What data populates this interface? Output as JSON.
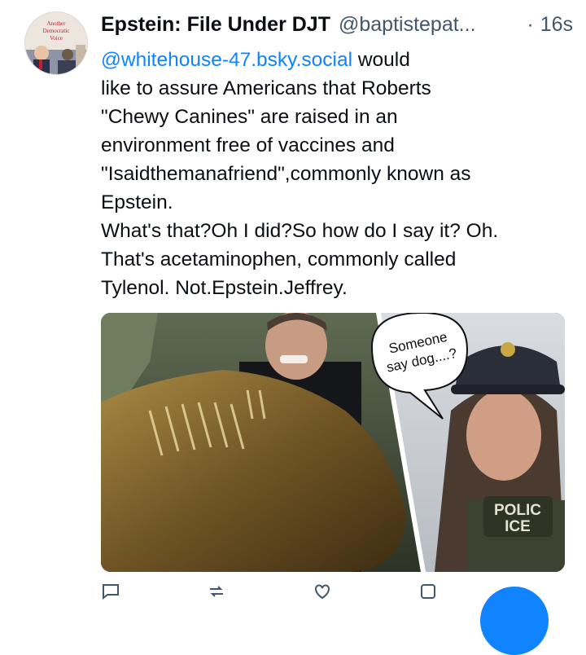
{
  "post": {
    "author": "Epstein: File Under DJT",
    "handle": "@baptistepat...",
    "separator": "·",
    "time": "16s",
    "avatar_text": "Another Democratic Voice",
    "mention": "@whitehouse-47.bsky.social",
    "lines": [
      " would",
      "like to assure Americans that Roberts",
      "\"Chewy Canines\" are raised in an",
      "environment free of vaccines and",
      "\"Isaidthemanafriend\",commonly known as",
      "Epstein.",
      "What's that?Oh I did?So how do I say it? Oh.",
      "That's acetaminophen, commonly called",
      "Tylenol. Not.Epstein.Jeffrey."
    ],
    "image": {
      "speech_bubble": [
        "Someone",
        "say dog....?"
      ],
      "badge": [
        "POLIC",
        "ICE"
      ]
    },
    "actions": [
      "reply-icon",
      "repost-icon",
      "like-icon",
      "more-icon"
    ],
    "colors": {
      "link": "#1083fe",
      "muted": "#42576c",
      "text": "#0b0f14"
    }
  }
}
